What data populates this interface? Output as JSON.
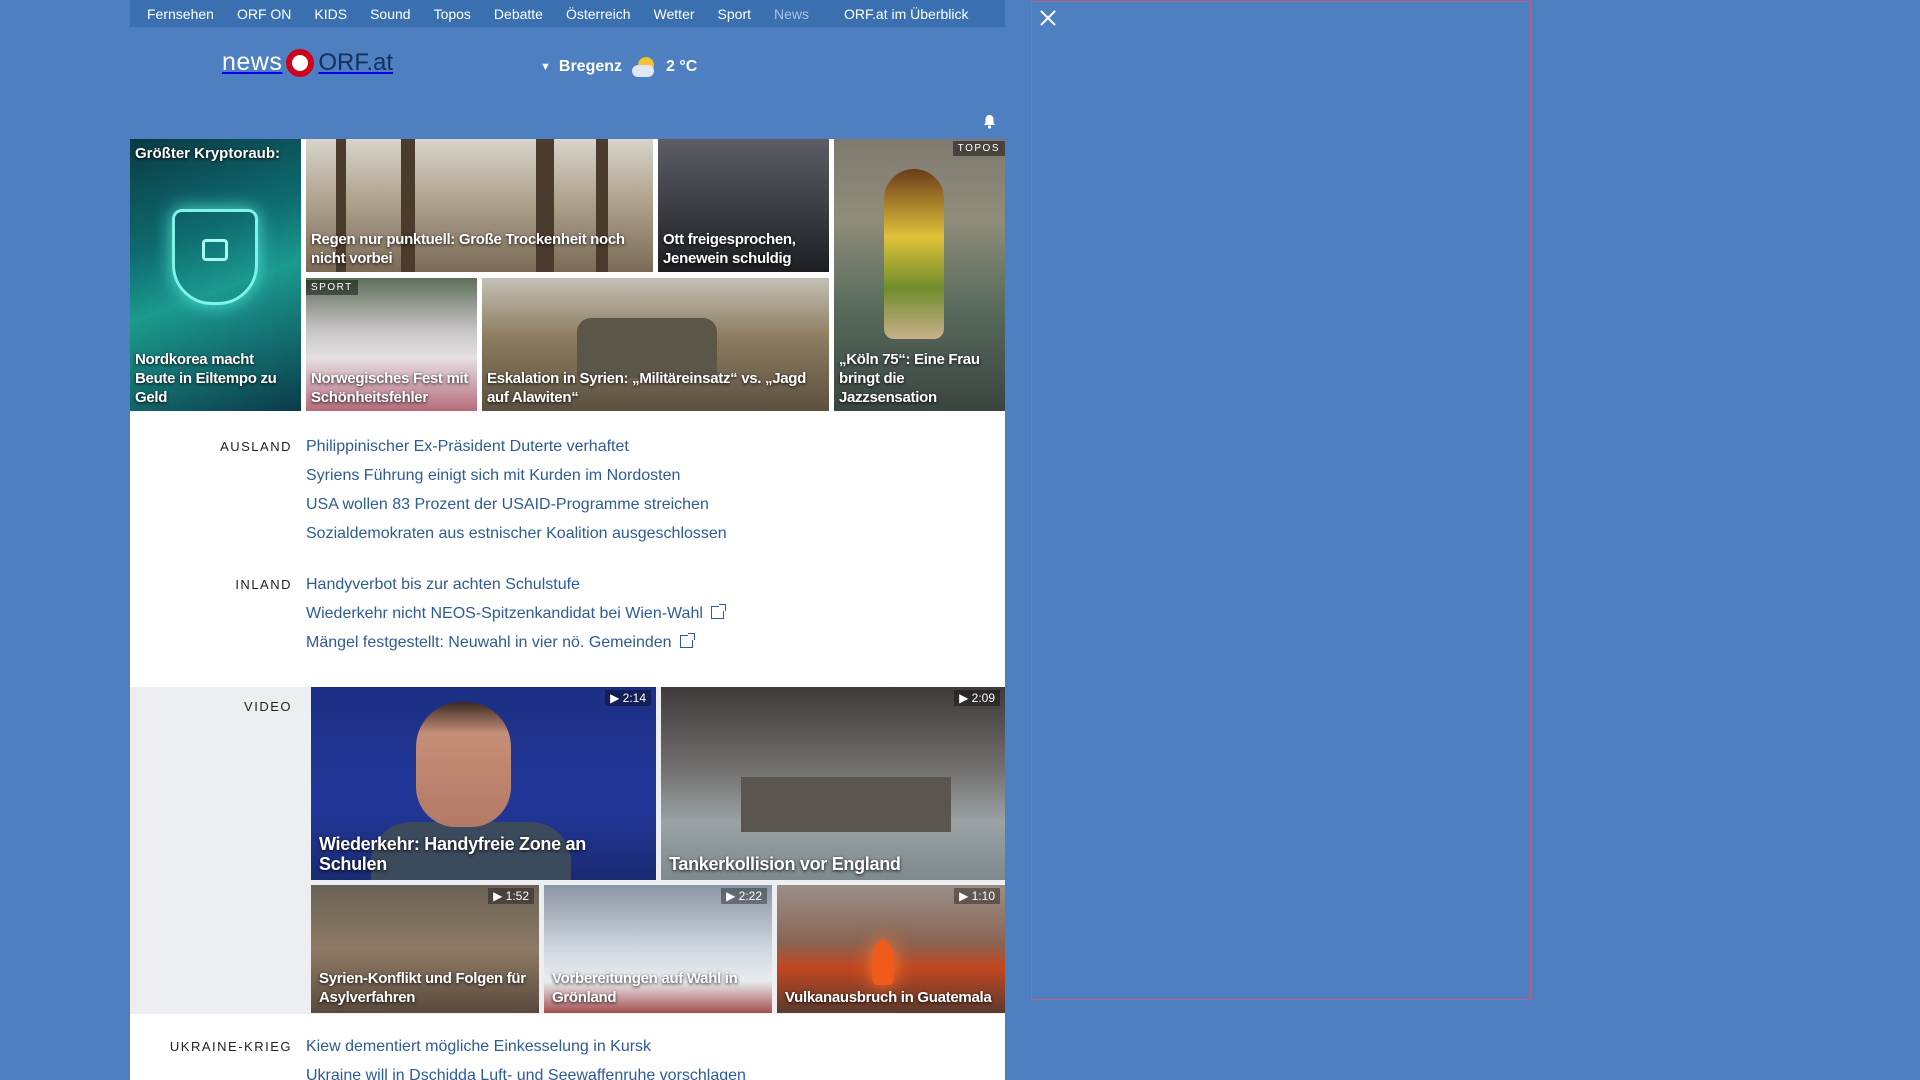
{
  "topnav": {
    "items": [
      "Fernsehen",
      "ORF ON",
      "KIDS",
      "Sound",
      "Topos",
      "Debatte",
      "Österreich",
      "Wetter",
      "Sport",
      "News"
    ],
    "active": "News",
    "overview": "ORF.at im Überblick"
  },
  "header": {
    "logo_news": "news",
    "logo_orf": "ORF.at",
    "weather": {
      "location": "Bregenz",
      "temperature": "2 °C",
      "icon": "sun-cloud-icon"
    }
  },
  "tiles": {
    "crypto_top": "Größter Kryptoraub:",
    "crypto_caption": "Nordkorea macht Beute in Eiltempo zu Geld",
    "rain_caption": "Regen nur punktuell: Große Trockenheit noch nicht vorbei",
    "ott_caption": "Ott freigesprochen, Jenewein schuldig",
    "koeln_tag": "TOPOS",
    "koeln_caption": "„Köln 75“: Eine Frau bringt die Jazzsensation",
    "sport_tag": "SPORT",
    "sport_caption": "Norwegisches Fest mit Schönheitsfehler",
    "syrien_caption": "Eskalation in Syrien: „Militäreinsatz“ vs. „Jagd auf Alawiten“"
  },
  "ausland": {
    "label": "AUSLAND",
    "items": [
      "Philippinischer Ex-Präsident Duterte verhaftet",
      "Syriens Führung einigt sich mit Kurden im Nordosten",
      "USA wollen 83 Prozent der USAID-Programme streichen",
      "Sozialdemokraten aus estnischer Koalition ausgeschlossen"
    ]
  },
  "inland": {
    "label": "INLAND",
    "items": [
      "Handyverbot bis zur achten Schulstufe",
      "Wiederkehr nicht NEOS-Spitzenkandidat bei Wien-Wahl",
      "Mängel festgestellt: Neuwahl in vier nö. Gemeinden"
    ]
  },
  "video": {
    "label": "VIDEO",
    "items": [
      {
        "title": "Wiederkehr: Handyfreie Zone an Schulen",
        "duration": "2:14"
      },
      {
        "title": "Tankerkollision vor England",
        "duration": "2:09"
      },
      {
        "title": "Syrien-Konflikt und Folgen für Asylverfahren",
        "duration": "1:52"
      },
      {
        "title": "Vorbereitungen auf Wahl in Grönland",
        "duration": "2:22"
      },
      {
        "title": "Vulkanausbruch in Guatemala",
        "duration": "1:10"
      }
    ]
  },
  "ukraine": {
    "label": "UKRAINE-KRIEG",
    "items": [
      "Kiew dementiert mögliche Einkesselung in Kursk",
      "Ukraine will in Dschidda Luft- und Seewaffenruhe vorschlagen"
    ]
  },
  "colors": {
    "page_bg": "#4e80c1",
    "link": "#2d5b98",
    "logo_red": "#d0021b"
  }
}
